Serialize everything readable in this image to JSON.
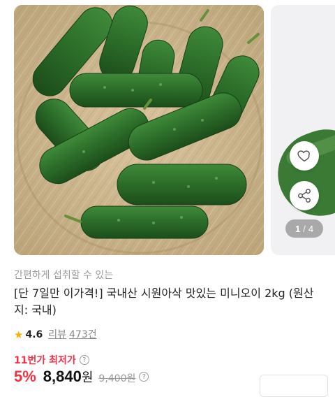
{
  "gallery": {
    "image_alt": "cucumbers-in-bamboo-basket",
    "current_page": "1",
    "page_separator": "/",
    "total_pages": "4"
  },
  "actions": {
    "like_icon": "heart-icon",
    "share_icon": "share-icon"
  },
  "product": {
    "subtitle": "간편하게 섭취할 수 있는",
    "title": "[단 7일만 이가격!] 국내산 시원아삭 맛있는 미니오이 2kg (원산지: 국내)",
    "rating": "4.6",
    "review_label": "리뷰",
    "review_count": "473건"
  },
  "pricing": {
    "lowest_label": "11번가 최저가",
    "discount": "5%",
    "price": "8,840",
    "currency": "원",
    "original_price": "9,400원",
    "accent_color": "#f43142"
  }
}
